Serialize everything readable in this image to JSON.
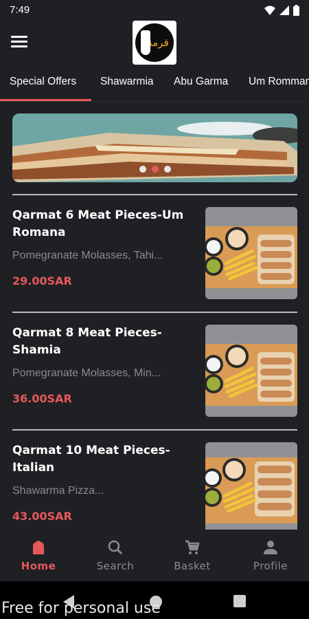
{
  "status_bar": {
    "time": "7:49"
  },
  "tabs": [
    {
      "label": "Special Offers",
      "active": true
    },
    {
      "label": "Shawarmia",
      "active": false
    },
    {
      "label": "Abu Garma",
      "active": false
    },
    {
      "label": "Um Romman",
      "active": false
    }
  ],
  "banner": {
    "slide_count": 3,
    "active_slide": 2
  },
  "products": [
    {
      "name": "Qarmat 6 Meat Pieces-Um Romana",
      "description": "Pomegranate Molasses, Tahi...",
      "price": "29.00SAR"
    },
    {
      "name": "Qarmat 8 Meat Pieces-Shamia",
      "description": "Pomegranate Molasses, Min...",
      "price": "36.00SAR"
    },
    {
      "name": "Qarmat 10 Meat Pieces-Italian",
      "description": "Shawarma Pizza...",
      "price": "43.00SAR"
    }
  ],
  "bottom_nav": [
    {
      "label": "Home",
      "icon": "home-icon",
      "active": true
    },
    {
      "label": "Search",
      "icon": "search-icon",
      "active": false
    },
    {
      "label": "Basket",
      "icon": "cart-icon",
      "active": false
    },
    {
      "label": "Profile",
      "icon": "person-icon",
      "active": false
    }
  ],
  "watermark": "Free for personal use",
  "colors": {
    "accent": "#e5585b",
    "background": "#1f2024",
    "muted_text": "#8a8b8f"
  }
}
